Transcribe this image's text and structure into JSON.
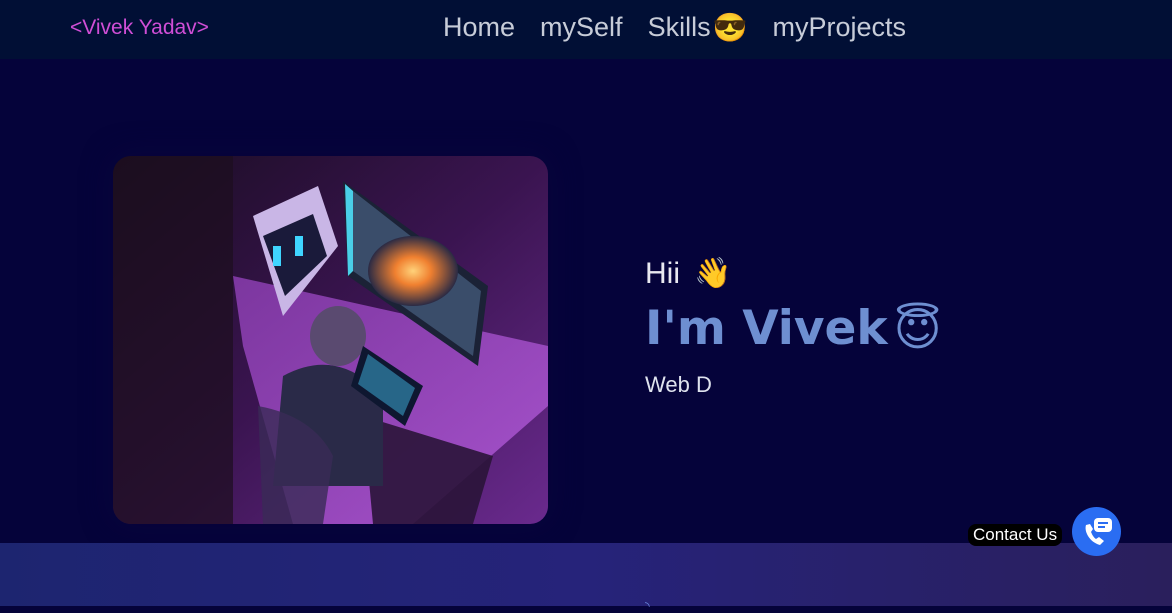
{
  "header": {
    "brand": "<Vivek Yadav>",
    "nav": [
      {
        "label": "Home"
      },
      {
        "label": "mySelf"
      },
      {
        "label": "Skills",
        "emoji": "😎"
      },
      {
        "label": "myProjects"
      }
    ]
  },
  "hero": {
    "image_icon": "gaming-setup-photo",
    "greeting": "Hii",
    "greeting_emoji": "👋",
    "headline": "I'm Vivek",
    "headline_emoji": "😇",
    "role": "Web D"
  },
  "contact": {
    "label": "Contact Us",
    "icon": "phone-chat-icon"
  },
  "colors": {
    "brand": "#d04ed6",
    "accent": "#6e8fd1",
    "background": "#05033a",
    "navbar": "#010f35",
    "contact_button": "#2a6df2"
  }
}
